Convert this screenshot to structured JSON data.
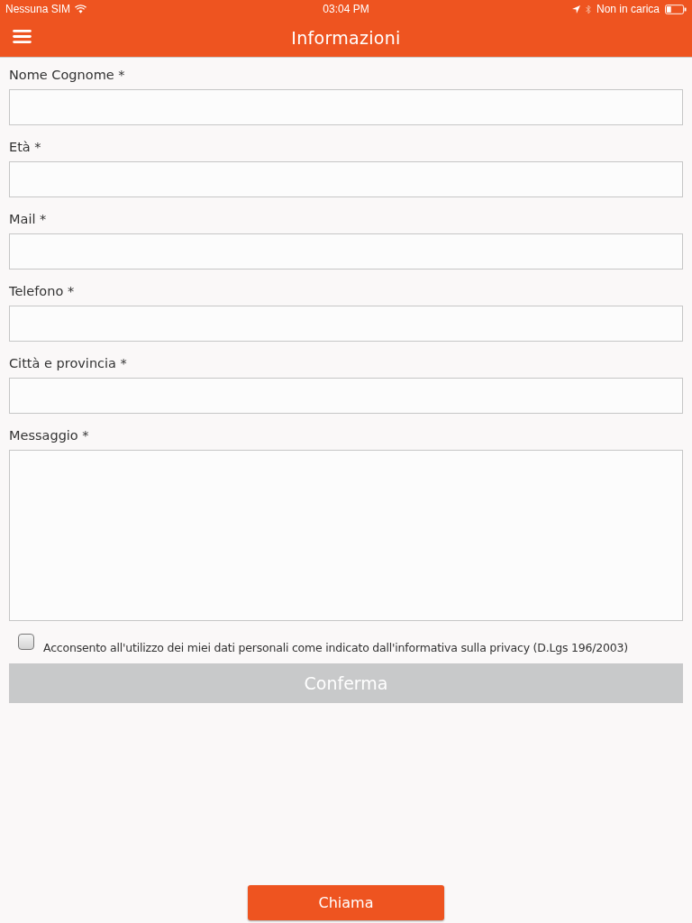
{
  "status_bar": {
    "carrier": "Nessuna SIM",
    "time": "03:04 PM",
    "battery_status": "Non in carica"
  },
  "nav_bar": {
    "title": "Informazioni"
  },
  "form": {
    "fields": [
      {
        "kind": "input",
        "label": "Nome Cognome *"
      },
      {
        "kind": "input",
        "label": "Età *"
      },
      {
        "kind": "input",
        "label": "Mail *"
      },
      {
        "kind": "input",
        "label": "Telefono *"
      },
      {
        "kind": "input",
        "label": "Città e provincia *"
      },
      {
        "kind": "textarea",
        "label": "Messaggio *"
      }
    ],
    "consent": {
      "checked": false,
      "text": "Acconsento all'utilizzo dei miei dati personali come indicato dall'informativa sulla privacy (D.Lgs 196/2003)"
    },
    "submit": {
      "label": "Conferma",
      "disabled": true
    }
  },
  "call_button": {
    "label": "Chiama"
  }
}
